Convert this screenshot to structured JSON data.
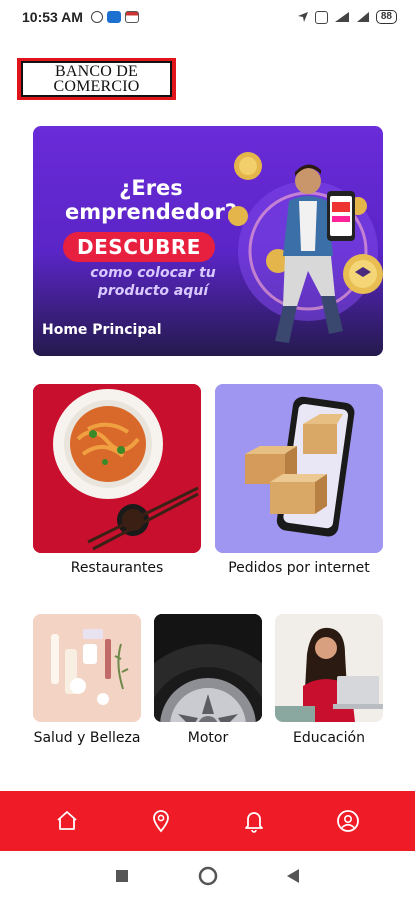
{
  "status_bar": {
    "time": "10:53 AM",
    "battery": "88"
  },
  "logo": {
    "line1": "BANCO DE",
    "line2": "COMERCIO"
  },
  "banner": {
    "headline_line1": "¿Eres",
    "headline_line2": "emprendedor?",
    "pill": "DESCUBRE",
    "sub_line1": "como colocar tu",
    "sub_line2": "producto aquí",
    "label": "Home Principal"
  },
  "categories": {
    "restaurantes": "Restaurantes",
    "pedidos": "Pedidos por internet",
    "salud": "Salud y Belleza",
    "motor": "Motor",
    "educacion": "Educación"
  },
  "bottom_nav": {
    "items": [
      "home-icon",
      "location-pin-icon",
      "bell-icon",
      "user-icon"
    ]
  },
  "colors": {
    "brand_red": "#ef1b26",
    "banner_purple": "#6a2bd9",
    "pedidos_bg": "#9f96f2"
  }
}
